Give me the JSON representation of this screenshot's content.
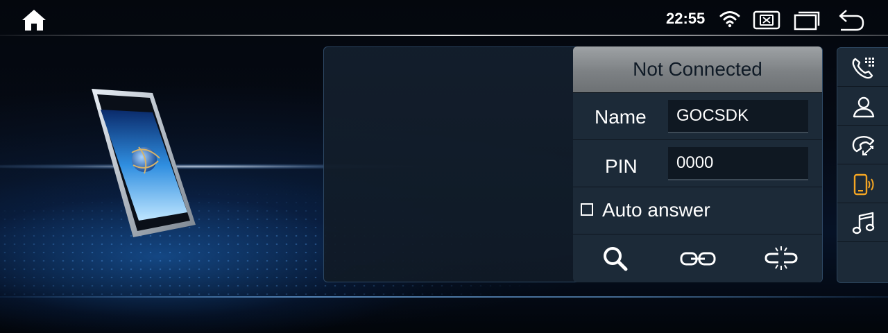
{
  "status_bar": {
    "time": "22:55",
    "icons": [
      "home-icon",
      "wifi-icon",
      "close-box-icon",
      "recent-apps-icon",
      "back-icon"
    ]
  },
  "bluetooth": {
    "status": "Not Connected",
    "name_label": "Name",
    "name_value": "GOCSDK",
    "pin_label": "PIN",
    "pin_value": "0000",
    "auto_answer_label": "Auto answer",
    "auto_answer_checked": false,
    "actions": [
      "search-icon",
      "link-icon",
      "unlink-icon"
    ]
  },
  "side_nav": {
    "items": [
      "dialpad-icon",
      "contacts-icon",
      "call-log-icon",
      "phone-bluetooth-icon",
      "music-icon"
    ],
    "active": "phone-bluetooth-icon"
  },
  "colors": {
    "accent": "#f5a623",
    "panel": "#1c2a38",
    "header": "#8a8e91"
  }
}
